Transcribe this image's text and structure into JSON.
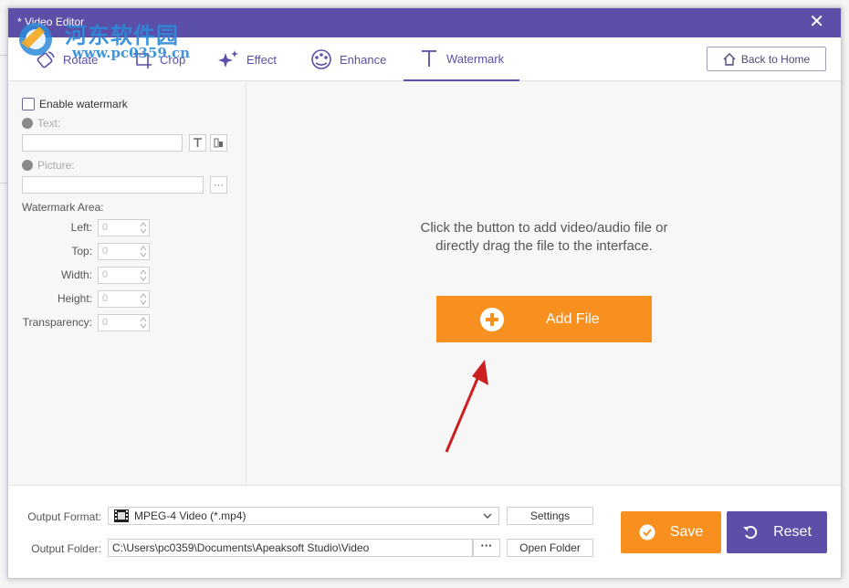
{
  "window": {
    "title": "* Video Editor",
    "close_glyph": "✕"
  },
  "site_watermark": {
    "name": "河东软件园",
    "url": "www.pc0359.cn"
  },
  "tabs": [
    {
      "label": "Rotate",
      "icon": "rotate-icon",
      "active": false
    },
    {
      "label": "Crop",
      "icon": "crop-icon",
      "active": false
    },
    {
      "label": "Effect",
      "icon": "effect-icon",
      "active": false
    },
    {
      "label": "Enhance",
      "icon": "enhance-icon",
      "active": false
    },
    {
      "label": "Watermark",
      "icon": "text-icon",
      "active": true
    }
  ],
  "back_home_label": "Back to Home",
  "left": {
    "enable_label": "Enable watermark",
    "text_label": "Text:",
    "picture_label": "Picture:",
    "picture_browse": "···",
    "area_label": "Watermark Area:",
    "fields": [
      {
        "label": "Left:",
        "value": "0"
      },
      {
        "label": "Top:",
        "value": "0"
      },
      {
        "label": "Width:",
        "value": "0"
      },
      {
        "label": "Height:",
        "value": "0"
      },
      {
        "label": "Transparency:",
        "value": "0"
      }
    ]
  },
  "main": {
    "hint_line1": "Click the button to add video/audio file or",
    "hint_line2": "directly drag the file to the interface.",
    "add_file_label": "Add File"
  },
  "bottom": {
    "output_format_label": "Output Format:",
    "output_format_value": "MPEG-4 Video (*.mp4)",
    "settings_label": "Settings",
    "output_folder_label": "Output Folder:",
    "output_folder_value": "C:\\Users\\pc0359\\Documents\\Apeaksoft Studio\\Video",
    "browse_label": "···",
    "open_folder_label": "Open Folder",
    "save_label": "Save",
    "reset_label": "Reset"
  },
  "colors": {
    "accent": "#5b4fa8",
    "orange": "#f7901e",
    "annotation_arrow": "#cc1f1f"
  }
}
